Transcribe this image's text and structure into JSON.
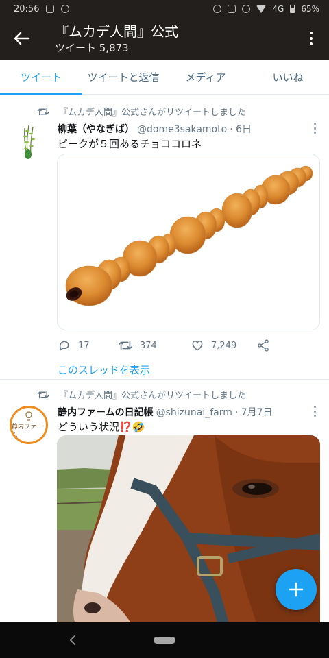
{
  "status_bar": {
    "time": "20:56",
    "network": "4G",
    "battery": "65%"
  },
  "app_bar": {
    "title": "『ムカデ人間』公式",
    "subtitle": "ツイート 5,873"
  },
  "tabs": [
    {
      "label": "ツイート",
      "active": true
    },
    {
      "label": "ツイートと返信",
      "active": false
    },
    {
      "label": "メディア",
      "active": false
    },
    {
      "label": "いいね",
      "active": false
    }
  ],
  "tweets": [
    {
      "retweet_text": "『ムカデ人間』公式さんがリツイートしました",
      "name": "柳葉（やなぎば）",
      "handle": "@dome3sakamoto",
      "time": "· 6日",
      "text": "ピークが５回あるチョココロネ",
      "replies": "17",
      "retweets": "374",
      "likes": "7,249",
      "thread_link": "このスレッドを表示"
    },
    {
      "retweet_text": "『ムカデ人間』公式さんがリツイートしました",
      "name": "静内ファームの日記帳",
      "handle": "@shizunai_farm",
      "time": "· 7月7日",
      "text": "どういう状況⁉️🤣",
      "avatar_text": "静内ファーム"
    }
  ],
  "colors": {
    "accent": "#1da1f2",
    "appbar": "#231f1c",
    "secondary_text": "#657786"
  },
  "icons": [
    "back-arrow-icon",
    "more-vert-icon",
    "retweet-icon",
    "reply-icon",
    "like-icon",
    "share-icon",
    "compose-plus-icon"
  ]
}
